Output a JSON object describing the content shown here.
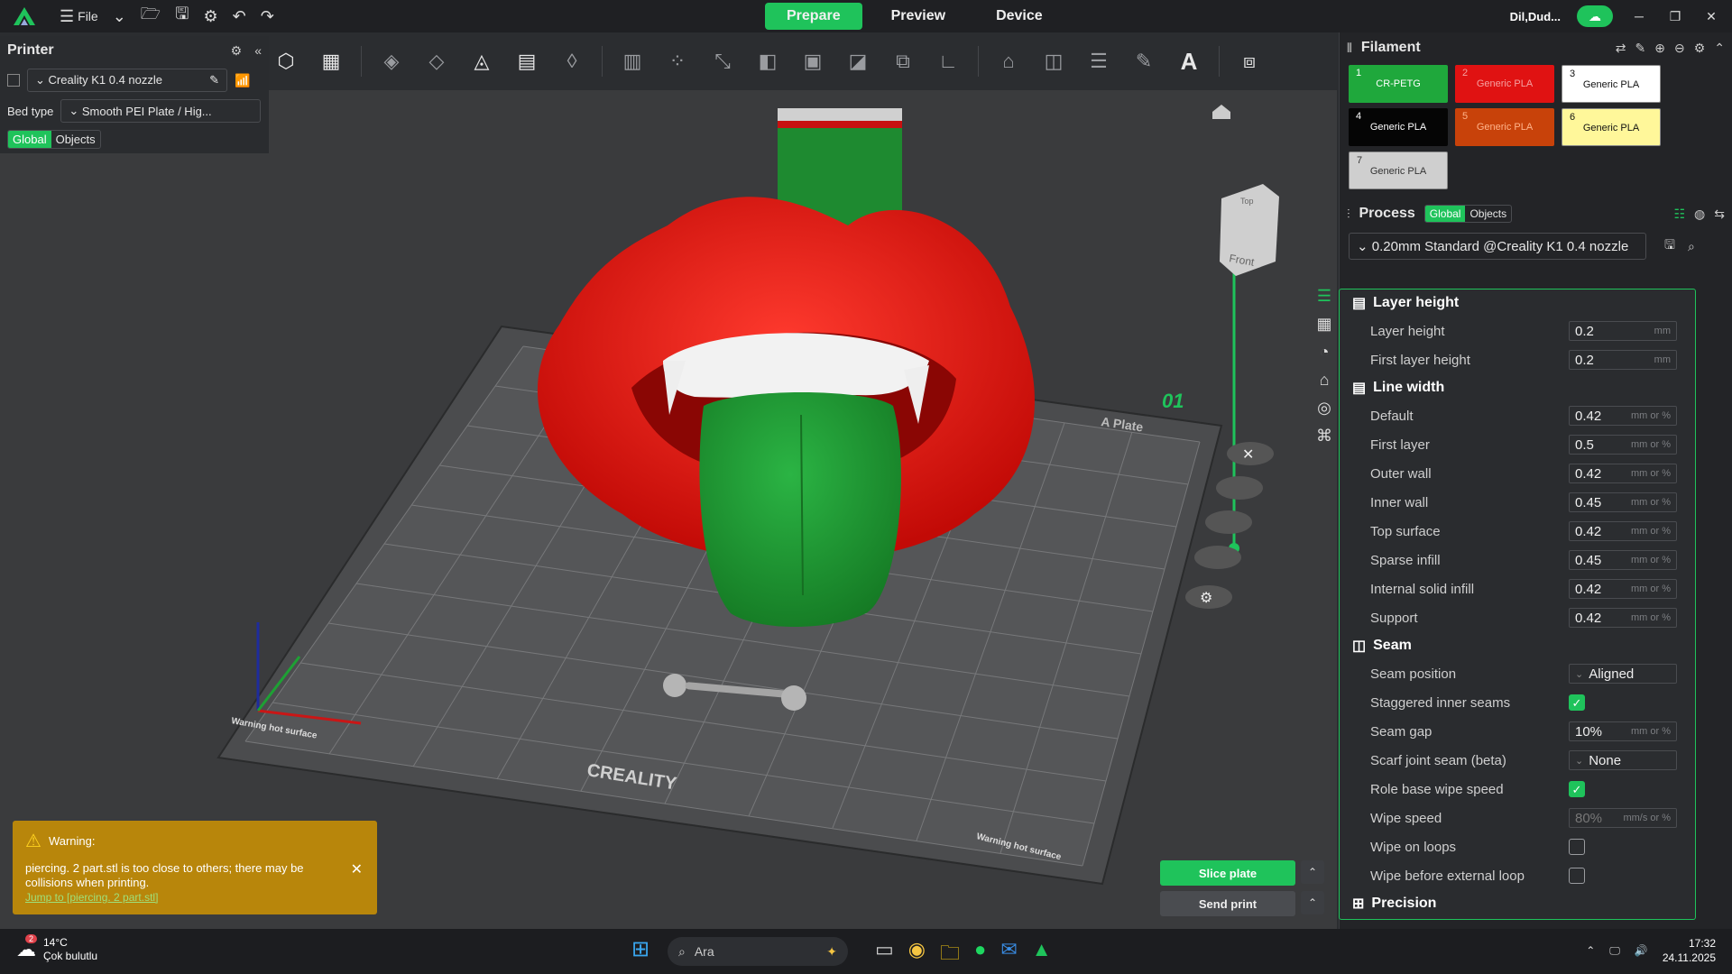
{
  "titlebar": {
    "file_label": "File",
    "tabs": [
      {
        "label": "Prepare"
      },
      {
        "label": "Preview"
      },
      {
        "label": "Device"
      }
    ],
    "user": "Dil,Dud..."
  },
  "printer_panel": {
    "title": "Printer",
    "printer_name": "Creality K1 0.4 nozzle",
    "bed_type_label": "Bed type",
    "bed_type_value": "Smooth PEI Plate / Hig...",
    "scope_global": "Global",
    "scope_objects": "Objects"
  },
  "viewport": {
    "plate_label": "A Plate",
    "plate_number": "01",
    "plate_brand": "CREALITY",
    "warning_hot_left": "Warning hot surface",
    "warning_hot_right": "Warning hot surface",
    "cube_top": "Top",
    "cube_front": "Front",
    "colors": {
      "lips": "#e8150f",
      "tongue": "#1e9a30",
      "teeth": "#f2f2f2",
      "bed": "#4b4c4e",
      "grid": "#7a7b7d",
      "slider": "#1fc35b"
    }
  },
  "filament": {
    "title": "Filament",
    "slots": [
      {
        "num": "1",
        "type": "CR-PETG",
        "color": "#1fa83c",
        "text_color": "#ffffff"
      },
      {
        "num": "2",
        "type": "Generic PLA",
        "color": "#e01212",
        "text_color": "#f5a0a0"
      },
      {
        "num": "3",
        "type": "Generic PLA",
        "color": "#ffffff",
        "text_color": "#111111"
      },
      {
        "num": "4",
        "type": "Generic PLA",
        "color": "#050505",
        "text_color": "#ffffff"
      },
      {
        "num": "5",
        "type": "Generic PLA",
        "color": "#c8420a",
        "text_color": "#ffb38a"
      },
      {
        "num": "6",
        "type": "Generic PLA",
        "color": "#fff79a",
        "text_color": "#111111"
      },
      {
        "num": "7",
        "type": "Generic PLA",
        "color": "#cfcfcf",
        "text_color": "#333333"
      }
    ]
  },
  "process": {
    "title": "Process",
    "scope_global": "Global",
    "scope_objects": "Objects",
    "profile": "0.20mm Standard @Creality K1 0.4 nozzle",
    "sections": {
      "layer_height": "Layer height",
      "line_width": "Line width",
      "seam": "Seam",
      "precision": "Precision"
    },
    "layer_height": {
      "label": "Layer height",
      "value": "0.2",
      "unit": "mm"
    },
    "first_layer_height": {
      "label": "First layer height",
      "value": "0.2",
      "unit": "mm"
    },
    "line_widths": [
      {
        "label": "Default",
        "value": "0.42",
        "unit": "mm or %"
      },
      {
        "label": "First layer",
        "value": "0.5",
        "unit": "mm or %"
      },
      {
        "label": "Outer wall",
        "value": "0.42",
        "unit": "mm or %"
      },
      {
        "label": "Inner wall",
        "value": "0.45",
        "unit": "mm or %"
      },
      {
        "label": "Top surface",
        "value": "0.42",
        "unit": "mm or %"
      },
      {
        "label": "Sparse infill",
        "value": "0.45",
        "unit": "mm or %"
      },
      {
        "label": "Internal solid infill",
        "value": "0.42",
        "unit": "mm or %"
      },
      {
        "label": "Support",
        "value": "0.42",
        "unit": "mm or %"
      }
    ],
    "seam_position": {
      "label": "Seam position",
      "value": "Aligned"
    },
    "staggered": {
      "label": "Staggered inner seams"
    },
    "seam_gap": {
      "label": "Seam gap",
      "value": "10%",
      "unit": "mm or %"
    },
    "scarf": {
      "label": "Scarf joint seam (beta)",
      "value": "None"
    },
    "role_wipe": {
      "label": "Role base wipe speed"
    },
    "wipe_speed": {
      "label": "Wipe speed",
      "value": "80%",
      "unit": "mm/s or %"
    },
    "wipe_loops": {
      "label": "Wipe on loops"
    },
    "wipe_ext": {
      "label": "Wipe before external loop"
    }
  },
  "warning": {
    "title": "Warning:",
    "message": "piercing. 2 part.stl is too close to others; there may be collisions when printing.",
    "link": "Jump to [piercing. 2 part.stl]"
  },
  "actions": {
    "slice": "Slice plate",
    "send": "Send print"
  },
  "taskbar": {
    "weather_temp": "14°C",
    "weather_desc": "Çok bulutlu",
    "weather_badge": "2",
    "search_placeholder": "Ara",
    "time": "17:32",
    "date": "24.11.2025"
  }
}
